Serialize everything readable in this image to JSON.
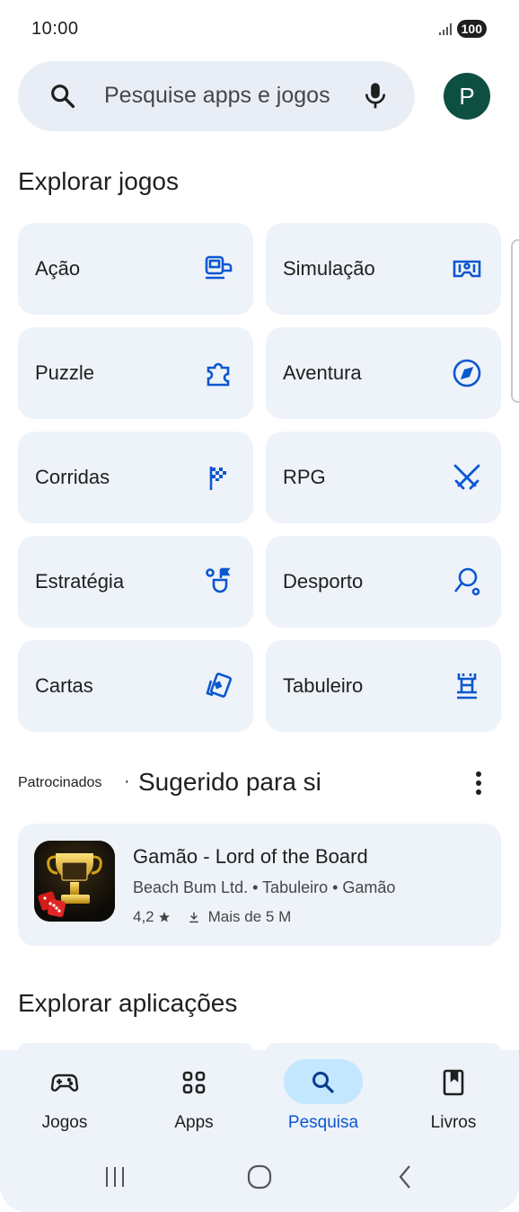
{
  "status": {
    "time": "10:00",
    "battery": "100"
  },
  "search": {
    "placeholder": "Pesquise apps e jogos",
    "avatar_letter": "P"
  },
  "explore_games": {
    "title": "Explorar jogos",
    "categories": [
      {
        "label": "Ação",
        "icon": "arcade-machine-icon"
      },
      {
        "label": "Simulação",
        "icon": "vr-headset-icon"
      },
      {
        "label": "Puzzle",
        "icon": "puzzle-piece-icon"
      },
      {
        "label": "Aventura",
        "icon": "compass-icon"
      },
      {
        "label": "Corridas",
        "icon": "checkered-flag-icon"
      },
      {
        "label": "RPG",
        "icon": "crossed-swords-icon"
      },
      {
        "label": "Estratégia",
        "icon": "strategy-flag-icon"
      },
      {
        "label": "Desporto",
        "icon": "ping-pong-icon"
      },
      {
        "label": "Cartas",
        "icon": "playing-card-icon"
      },
      {
        "label": "Tabuleiro",
        "icon": "chess-rook-icon"
      }
    ]
  },
  "suggested": {
    "sponsored_label": "Patrocinados",
    "separator": "·",
    "title": "Sugerido para si",
    "app": {
      "name": "Gamão - Lord of the Board",
      "meta": "Beach Bum Ltd. • Tabuleiro • Gamão",
      "rating": "4,2",
      "downloads": "Mais de 5 M"
    }
  },
  "explore_apps": {
    "title": "Explorar aplicações"
  },
  "bottom_nav": [
    {
      "label": "Jogos",
      "icon": "gamepad-icon",
      "active": false
    },
    {
      "label": "Apps",
      "icon": "apps-grid-icon",
      "active": false
    },
    {
      "label": "Pesquisa",
      "icon": "search-icon",
      "active": true
    },
    {
      "label": "Livros",
      "icon": "book-icon",
      "active": false
    }
  ],
  "colors": {
    "accent": "#0b57d0",
    "tile_bg": "#eef2f9",
    "avatar": "#0d5042",
    "active_pill": "#c2e7ff"
  }
}
